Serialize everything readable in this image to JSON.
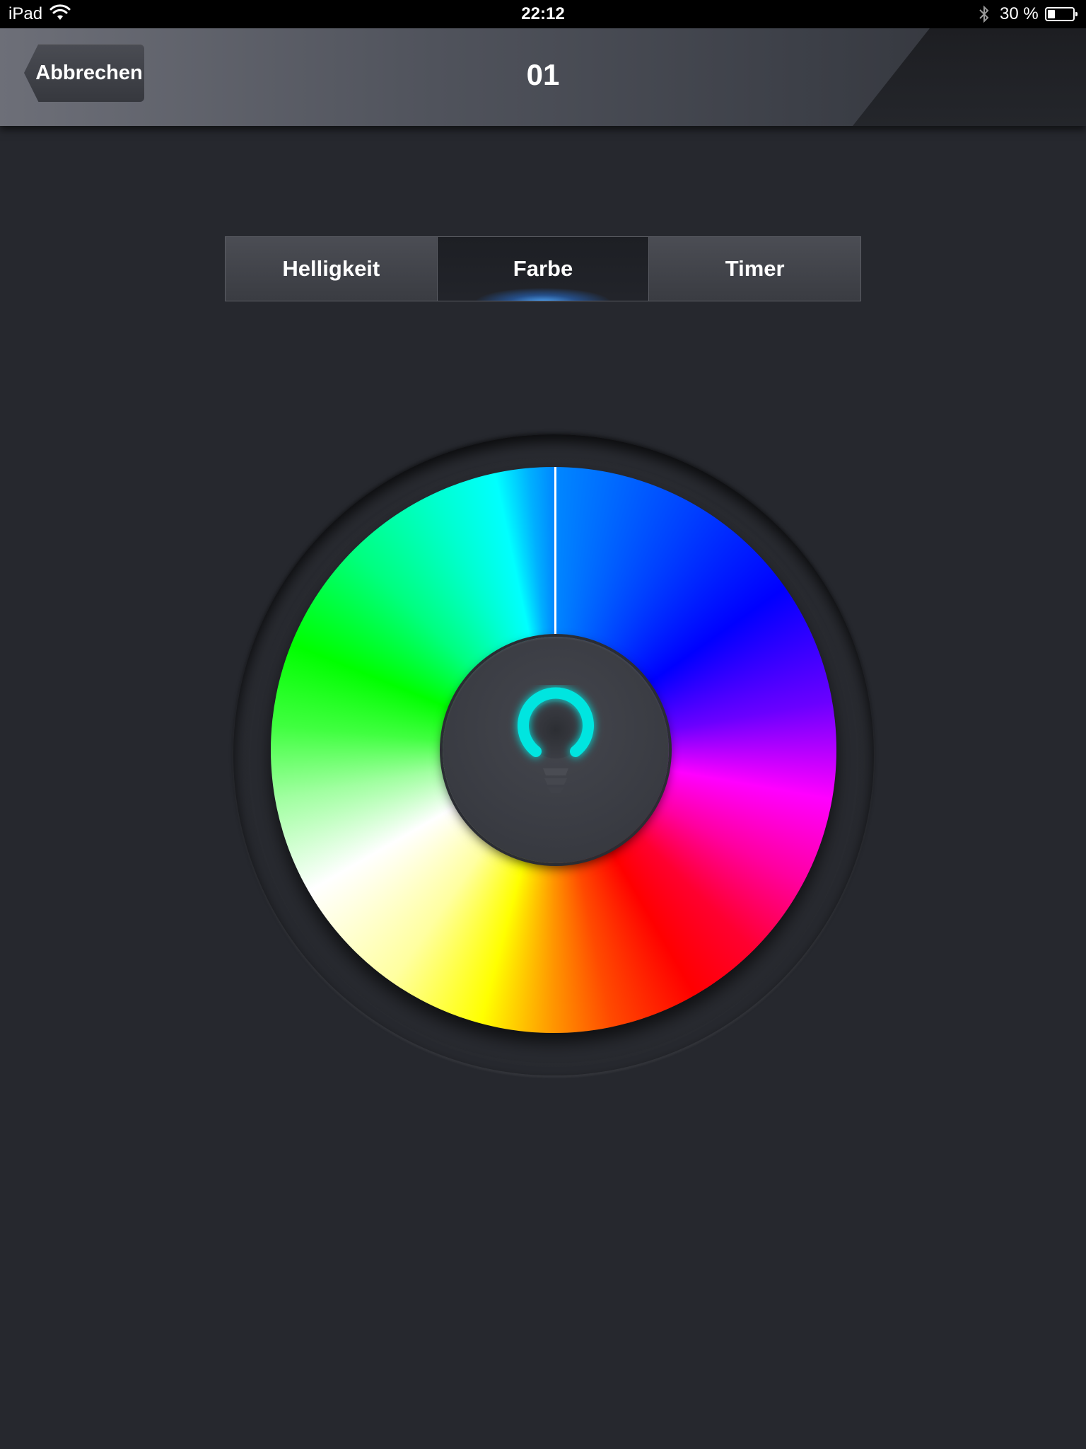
{
  "status_bar": {
    "device": "iPad",
    "time": "22:12",
    "battery_text": "30 %",
    "battery_level": 0.3,
    "icons": [
      "wifi-icon",
      "bluetooth-icon",
      "battery-icon"
    ]
  },
  "nav": {
    "back_label": "Abbrechen",
    "title": "01"
  },
  "tabs": [
    {
      "label": "Helligkeit",
      "active": false
    },
    {
      "label": "Farbe",
      "active": true
    },
    {
      "label": "Timer",
      "active": false
    }
  ],
  "color_picker": {
    "center_icon": "light-bulb-icon",
    "icon_color": "#00e5e0",
    "indicator_color": "#ffffff"
  },
  "colors": {
    "background": "#26282e",
    "active_tab_glow": "#3aa0ff"
  }
}
